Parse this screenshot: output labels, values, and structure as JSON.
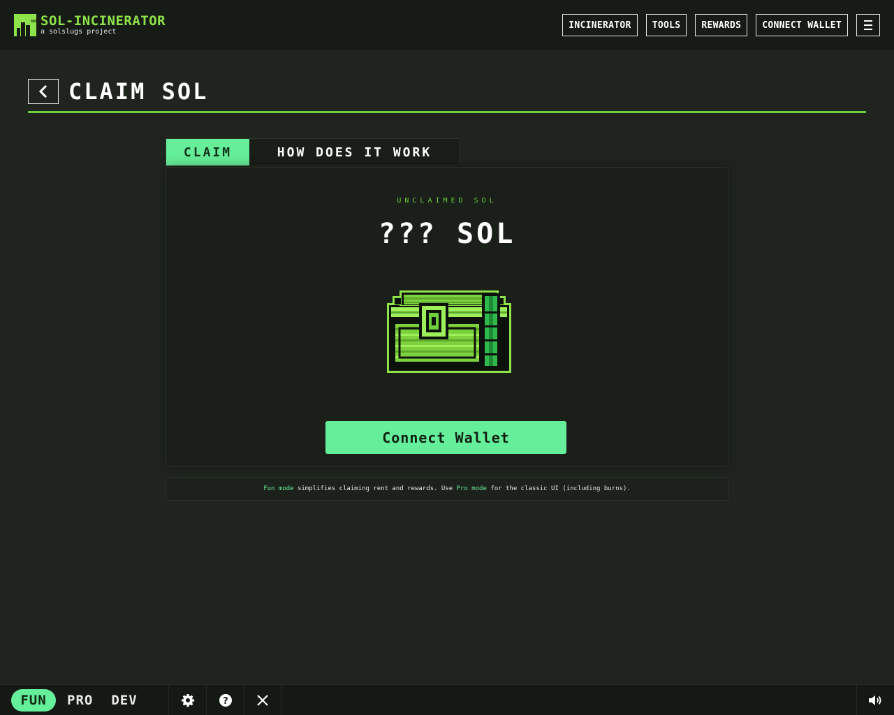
{
  "header": {
    "logo_title": "SOL-INCINERATOR",
    "logo_subtitle": "a solslugs project",
    "nav": [
      "INCINERATOR",
      "TOOLS",
      "REWARDS",
      "CONNECT WALLET"
    ],
    "menu_icon": "hamburger-icon"
  },
  "page": {
    "back_icon": "chevron-left-icon",
    "title": "CLAIM SOL"
  },
  "tabs": [
    "CLAIM",
    "HOW DOES IT WORK"
  ],
  "card": {
    "unclaimed_label": "UNCLAIMED SOL",
    "amount": "??? SOL",
    "chest_icon": "treasure-chest-icon",
    "connect_button": "Connect Wallet"
  },
  "info": {
    "fun_mode": "Fun mode",
    "middle": " simplifies claiming rent and rewards. Use ",
    "pro_mode": "Pro mode",
    "end": " for the classic UI (including burns)."
  },
  "footer": {
    "modes": [
      "FUN",
      "PRO",
      "DEV"
    ],
    "icons": [
      "gear-icon",
      "help-icon",
      "x-logo-icon",
      "speaker-icon"
    ]
  },
  "colors": {
    "accent_green": "#66ef9a",
    "logo_green": "#8fe34a",
    "divider_green": "#6fcf3a",
    "background": "#1f251e"
  }
}
